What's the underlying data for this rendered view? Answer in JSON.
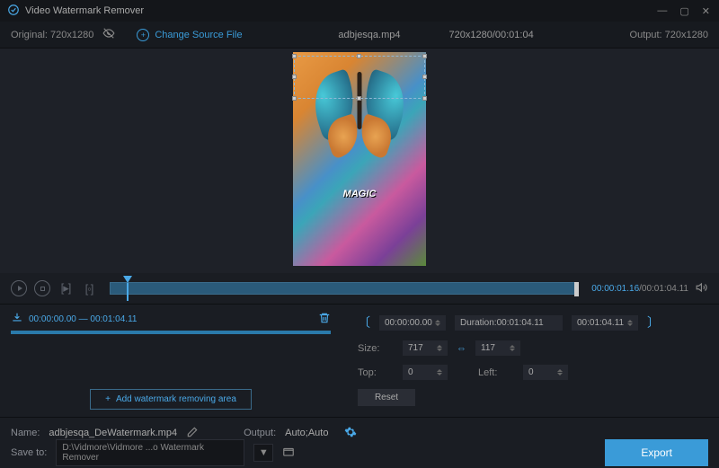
{
  "app": {
    "title": "Video Watermark Remover"
  },
  "topbar": {
    "original_label": "Original: 720x1280",
    "change_source": "Change Source File",
    "filename": "adbjesqa.mp4",
    "res_dur": "720x1280/00:01:04",
    "output_label": "Output: 720x1280"
  },
  "preview": {
    "magic_text": "MAGIC"
  },
  "timeline": {
    "current": "00:00:01.16",
    "total": "/00:01:04.11"
  },
  "region": {
    "range": "00:00:00.00 — 00:01:04.11"
  },
  "controls": {
    "start_time": "00:00:00.00",
    "duration_label": "Duration:00:01:04.11",
    "end_time": "00:01:04.11",
    "size_label": "Size:",
    "size_w": "717",
    "size_h": "117",
    "top_label": "Top:",
    "top_val": "0",
    "left_label": "Left:",
    "left_val": "0",
    "reset": "Reset"
  },
  "add_area": "Add watermark removing area",
  "bottom": {
    "name_label": "Name:",
    "name_value": "adbjesqa_DeWatermark.mp4",
    "output_label": "Output:",
    "output_value": "Auto;Auto",
    "saveto_label": "Save to:",
    "saveto_path": "D:\\Vidmore\\Vidmore ...o Watermark Remover",
    "export": "Export"
  }
}
